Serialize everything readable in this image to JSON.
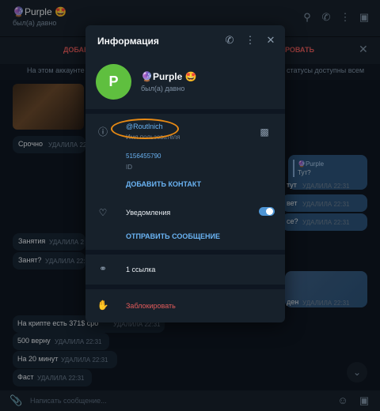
{
  "chat": {
    "title": "🔮Purple 🤩",
    "status": "был(а) давно",
    "banner_left": "ДОБАВ",
    "banner_right": "РОВАТЬ",
    "notice_left": "На этом аккаунте р",
    "notice_right": "статусы доступны всем",
    "input_placeholder": "Написать сообщение...",
    "reply": {
      "name": "🔮Purple",
      "text": "Тут?"
    },
    "messages_in": [
      {
        "text": "Срочно",
        "time": "УДАЛИЛА 22:31"
      },
      {
        "text": "Занятия",
        "time": "УДАЛИЛА 2"
      },
      {
        "text": "Занят?",
        "time": "УДАЛИЛА 22:31"
      },
      {
        "text": "На крипте есть 371$ сро",
        "time": "УДАЛИЛА 22:31"
      },
      {
        "text": "500 верну",
        "time": "УДАЛИЛА 22:31"
      },
      {
        "text": "На 20 минут",
        "time": "УДАЛИЛА 22:31"
      },
      {
        "text": "Фаст",
        "time": "УДАЛИЛА 22:31"
      }
    ],
    "messages_out": [
      {
        "text": "тут",
        "time": "УДАЛИЛА 22:31"
      },
      {
        "text": "вет",
        "time": "УДАЛИЛА 22:31"
      },
      {
        "text": "се?",
        "time": "УДАЛИЛА 22:31"
      },
      {
        "text": "ден",
        "time": "УДАЛИЛА 22:31"
      }
    ],
    "icons": [
      "search-icon",
      "phone-icon",
      "more-icon",
      "close-icon",
      "attach-icon",
      "emoji-icon",
      "camera-icon"
    ]
  },
  "modal": {
    "title": "Информация",
    "profile": {
      "initial": "P",
      "name": "🔮Purple 🤩",
      "status": "был(а) давно",
      "avatar_color": "#5fbf3f"
    },
    "username": {
      "value": "@Routlnich",
      "label": "Имя пользователя"
    },
    "id": {
      "value": "5156455790",
      "label": "ID"
    },
    "add_contact": "ДОБАВИТЬ КОНТАКТ",
    "notifications": {
      "label": "Уведомления",
      "enabled": true
    },
    "send_message": "ОТПРАВИТЬ СООБЩЕНИЕ",
    "links": "1 ссылка",
    "block": "Заблокировать"
  },
  "colors": {
    "accent": "#6ab3f3",
    "danger": "#e35b5b",
    "highlight": "#e88a14"
  }
}
